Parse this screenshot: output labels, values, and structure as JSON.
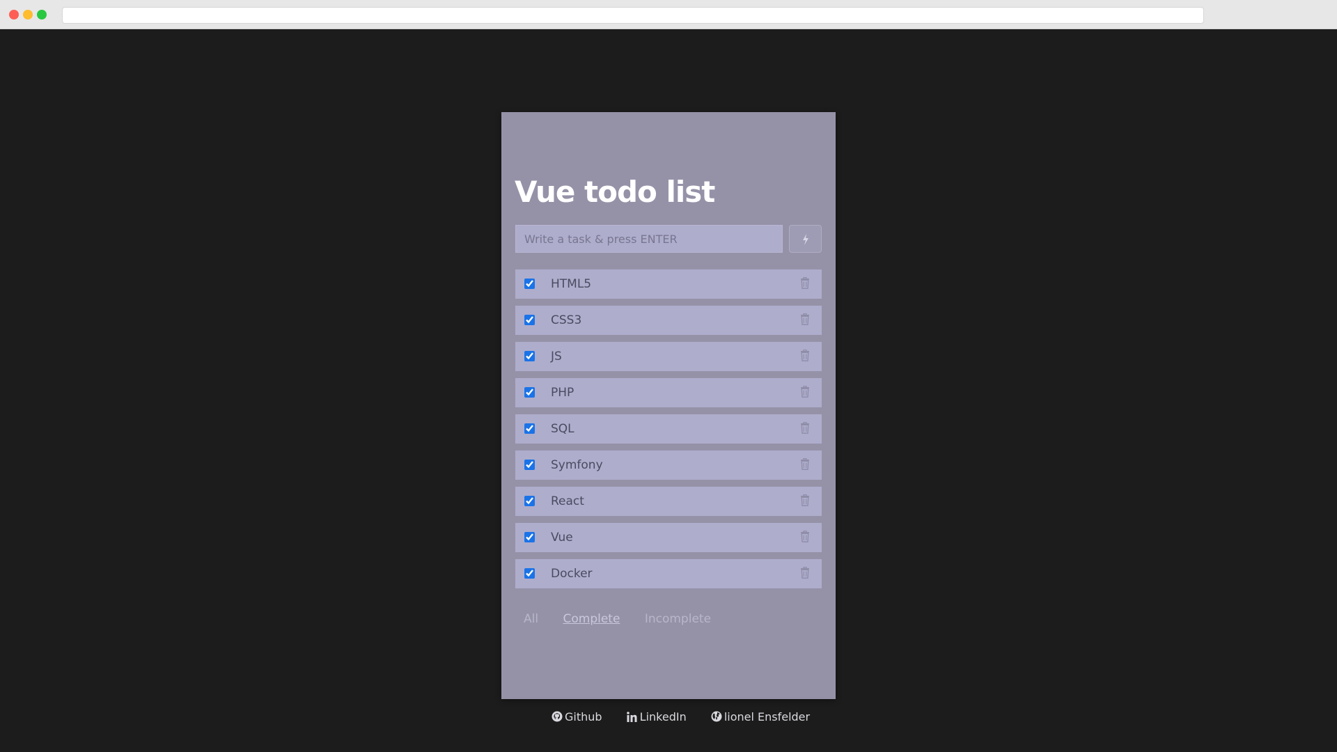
{
  "app": {
    "title": "Vue todo list"
  },
  "input": {
    "placeholder": "Write a task & press ENTER",
    "value": ""
  },
  "add_button": {
    "icon": "bolt-icon"
  },
  "todos": [
    {
      "label": "HTML5",
      "done": true
    },
    {
      "label": "CSS3",
      "done": true
    },
    {
      "label": "JS",
      "done": true
    },
    {
      "label": "PHP",
      "done": true
    },
    {
      "label": "SQL",
      "done": true
    },
    {
      "label": "Symfony",
      "done": true
    },
    {
      "label": "React",
      "done": true
    },
    {
      "label": "Vue",
      "done": true
    },
    {
      "label": "Docker",
      "done": true
    }
  ],
  "filters": {
    "all": "All",
    "complete": "Complete",
    "incomplete": "Incomplete",
    "active": "complete"
  },
  "footer": {
    "github": "Github",
    "linkedin": "LinkedIn",
    "website": "lionel Ensfelder"
  },
  "colors": {
    "page_bg": "#1c1c1c",
    "card_bg": "#9592a8",
    "item_bg": "#aeadcc",
    "checkbox_accent": "#1a73e8",
    "title_text": "#ffffff"
  }
}
